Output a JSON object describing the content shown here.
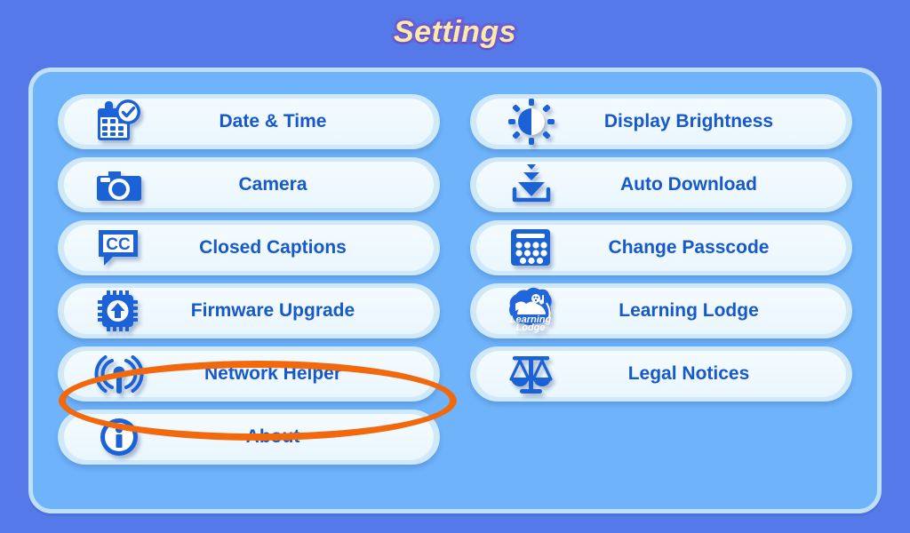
{
  "header": {
    "title": "Settings"
  },
  "colors": {
    "background": "#5579E8",
    "panel": "#6FB4FB",
    "panel_border": "#BFE0F8",
    "pill_outer": "#CFE8FA",
    "pill_inner": "#EFF8FE",
    "label_blue": "#1659CC",
    "icon_blue": "#1B62D6",
    "title_fill": "#FFE9A8",
    "title_outline": "#6A5FD6",
    "highlight": "#F2680D"
  },
  "panel": {
    "left_column": [
      {
        "label": "Date & Time",
        "icon": "calendar-clock-icon"
      },
      {
        "label": "Camera",
        "icon": "camera-icon"
      },
      {
        "label": "Closed Captions",
        "icon": "closed-captions-icon"
      },
      {
        "label": "Firmware Upgrade",
        "icon": "chip-upgrade-icon"
      },
      {
        "label": "Network Helper",
        "icon": "wireless-signal-icon"
      },
      {
        "label": "About",
        "icon": "info-circle-icon"
      }
    ],
    "right_column": [
      {
        "label": "Display Brightness",
        "icon": "brightness-icon"
      },
      {
        "label": "Auto Download",
        "icon": "download-tray-icon"
      },
      {
        "label": "Change Passcode",
        "icon": "keypad-icon"
      },
      {
        "label": "Learning Lodge",
        "icon": "learning-lodge-badge-icon"
      },
      {
        "label": "Legal Notices",
        "icon": "balance-scale-icon"
      }
    ]
  },
  "annotation": {
    "type": "ellipse-highlight",
    "target": "Network Helper",
    "color": "#F2680D"
  },
  "learning_lodge_badge": {
    "line1": "Learning",
    "line2": "Lodge"
  },
  "closed_captions_icon_text": "CC"
}
